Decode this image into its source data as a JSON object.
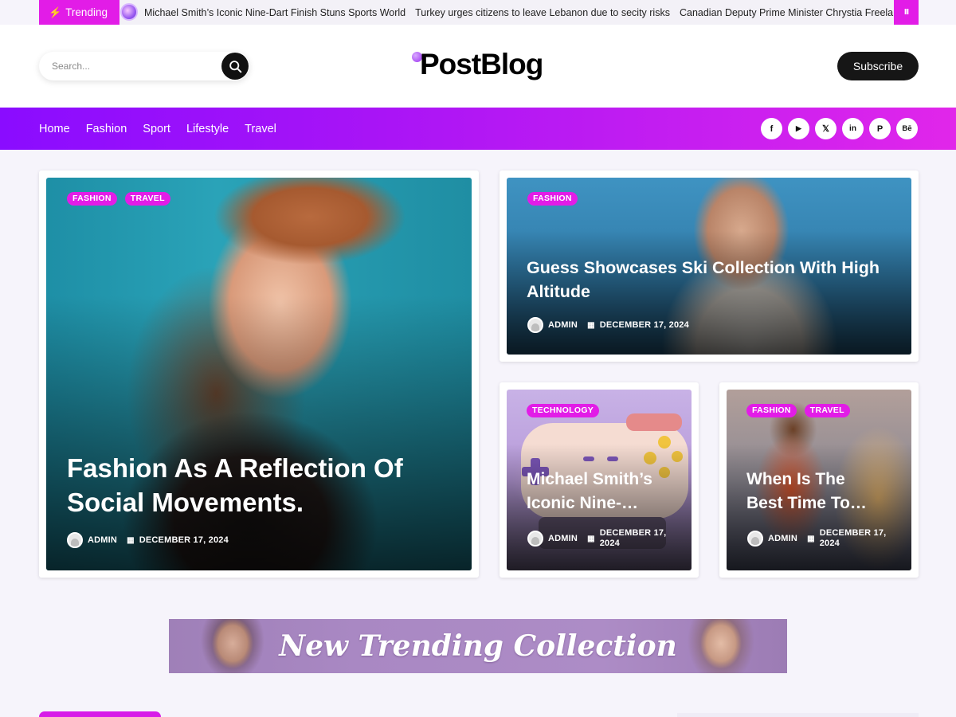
{
  "ticker": {
    "badge_label": "Trending",
    "items": [
      "Michael Smith’s Iconic Nine-Dart Finish Stuns Sports World",
      "Turkey urges citizens to leave Lebanon due to secity risks",
      "Canadian Deputy Prime Minister Chrystia Freelan"
    ],
    "pause_symbol": "II"
  },
  "header": {
    "search_placeholder": "Search...",
    "logo_text": "PostBlog",
    "subscribe_label": "Subscribe"
  },
  "nav": {
    "links": [
      "Home",
      "Fashion",
      "Sport",
      "Lifestyle",
      "Travel"
    ],
    "socials": [
      {
        "name": "facebook-icon",
        "glyph": "f"
      },
      {
        "name": "youtube-icon",
        "glyph": "▶"
      },
      {
        "name": "x-icon",
        "glyph": "𝕏"
      },
      {
        "name": "linkedin-icon",
        "glyph": "in"
      },
      {
        "name": "pinterest-icon",
        "glyph": "P"
      },
      {
        "name": "behance-icon",
        "glyph": "Bē"
      }
    ]
  },
  "posts": {
    "hero": {
      "tags": [
        "FASHION",
        "TRAVEL"
      ],
      "title": "Fashion As A Reflection Of Social Movements.",
      "author": "ADMIN",
      "date": "DECEMBER 17, 2024"
    },
    "top_right": {
      "tags": [
        "FASHION"
      ],
      "title": "Guess Showcases Ski Collection With High Altitude",
      "author": "ADMIN",
      "date": "DECEMBER 17, 2024"
    },
    "small_left": {
      "tags": [
        "TECHNOLOGY"
      ],
      "title": "Michael Smith’s Iconic Nine-…",
      "author": "ADMIN",
      "date": "DECEMBER 17, 2024"
    },
    "small_right": {
      "tags": [
        "FASHION",
        "TRAVEL"
      ],
      "title": "When Is The Best Time To…",
      "author": "ADMIN",
      "date": "DECEMBER 17, 2024"
    }
  },
  "banner": {
    "text": "New Trending Collection"
  },
  "colors": {
    "accent": "#e21ce7",
    "nav_gradient_start": "#8a0cff",
    "nav_gradient_end": "#e126ea",
    "dark": "#161616"
  }
}
